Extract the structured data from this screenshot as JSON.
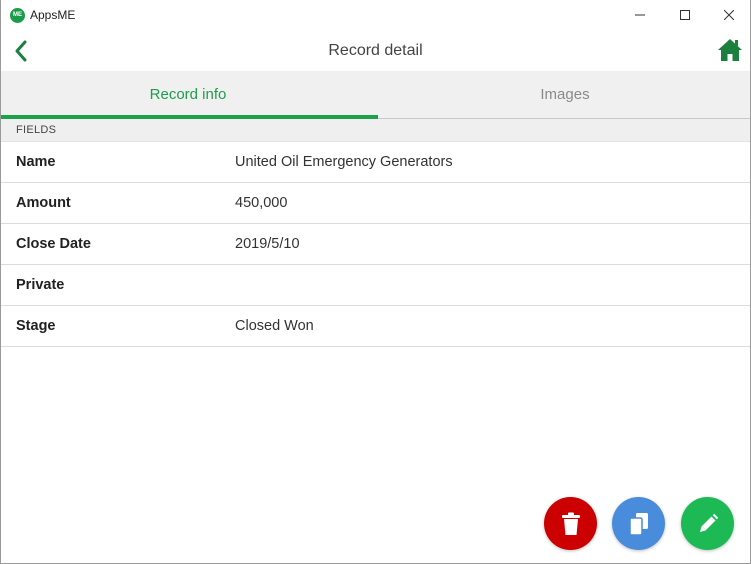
{
  "window": {
    "app_title": "AppsME",
    "logo_text": "ME"
  },
  "header": {
    "title": "Record detail"
  },
  "tabs": [
    {
      "label": "Record info",
      "active": true
    },
    {
      "label": "Images",
      "active": false
    }
  ],
  "section": {
    "label": "FIELDS"
  },
  "fields": [
    {
      "label": "Name",
      "value": "United Oil Emergency Generators"
    },
    {
      "label": "Amount",
      "value": "450,000"
    },
    {
      "label": "Close Date",
      "value": "2019/5/10"
    },
    {
      "label": "Private",
      "value": ""
    },
    {
      "label": "Stage",
      "value": "Closed Won"
    }
  ],
  "actions": {
    "delete_icon": "trash-icon",
    "copy_icon": "copy-icon",
    "edit_icon": "pencil-icon"
  },
  "colors": {
    "accent_green": "#1aa34a",
    "delete_red": "#cc0000",
    "copy_blue": "#4a8cdc",
    "edit_green": "#1db954",
    "home_green": "#1b7f3e"
  }
}
